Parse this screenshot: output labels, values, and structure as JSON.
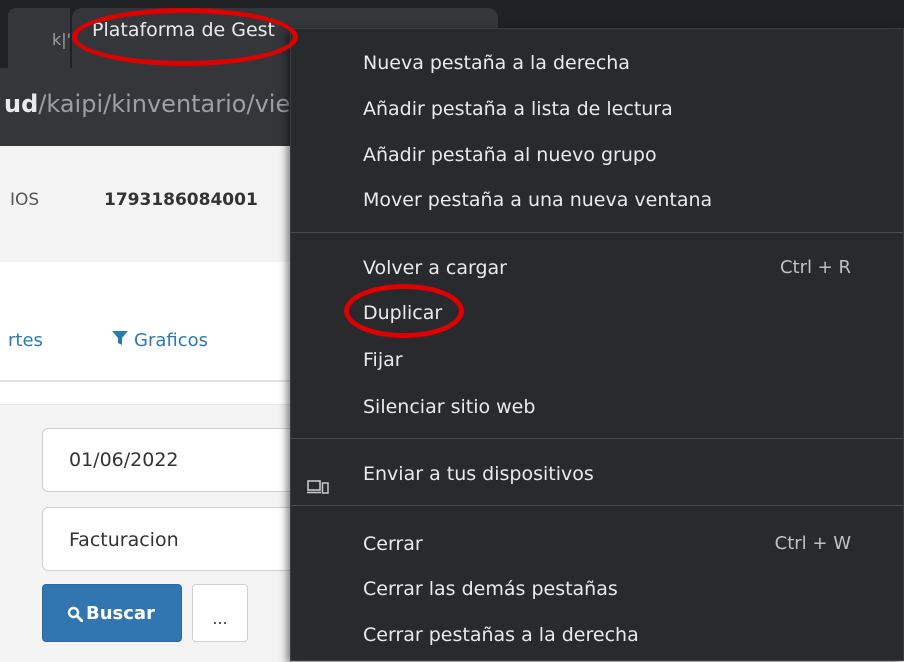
{
  "browser": {
    "left_tab_glyph": "k|'",
    "active_tab_title": "Plataforma de Gest",
    "url_host": "ud",
    "url_path": "/kaipi/kinventario/vie"
  },
  "page": {
    "info_label": "IOS",
    "ruc": "1793186084001",
    "nav_reportes": "rtes",
    "nav_graficos": "Graficos",
    "date_value": "01/06/2022",
    "modulo_value": "Facturacion",
    "buscar_label": "Buscar",
    "more_label": "..."
  },
  "context_menu": {
    "group1": [
      {
        "label": "Nueva pestaña a la derecha"
      },
      {
        "label": "Añadir pestaña a lista de lectura"
      },
      {
        "label": "Añadir pestaña al nuevo grupo"
      },
      {
        "label": "Mover pestaña a una nueva ventana"
      }
    ],
    "group2": [
      {
        "label": "Volver a cargar",
        "shortcut": "Ctrl + R"
      },
      {
        "label": "Duplicar"
      },
      {
        "label": "Fijar"
      },
      {
        "label": "Silenciar sitio web"
      }
    ],
    "group3": [
      {
        "label": "Enviar a tus dispositivos",
        "icon": "devices-icon"
      }
    ],
    "group4": [
      {
        "label": "Cerrar",
        "shortcut": "Ctrl + W"
      },
      {
        "label": "Cerrar las demás pestañas"
      },
      {
        "label": "Cerrar pestañas a la derecha"
      }
    ]
  },
  "colors": {
    "menu_bg": "#292a2d",
    "annotation": "#e00000",
    "primary_button": "#3276b1",
    "link": "#2a7ab0"
  }
}
